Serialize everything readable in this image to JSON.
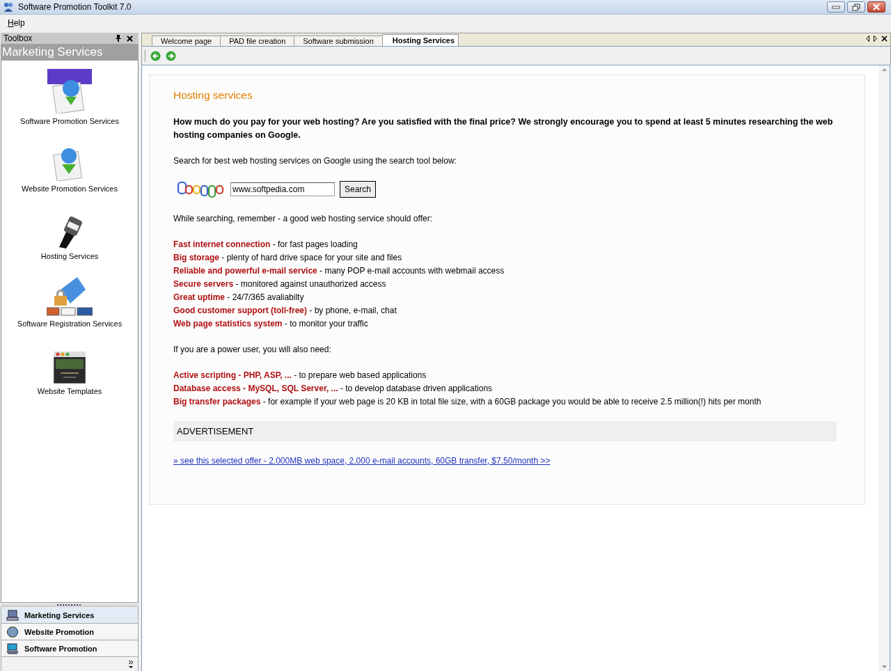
{
  "window": {
    "title": "Software Promotion Toolkit 7.0"
  },
  "menu": [
    {
      "label": "Help"
    }
  ],
  "toolbox": {
    "title": "Toolbox",
    "heading": "Marketing Services",
    "items": [
      {
        "kind": "pad",
        "label": "Software Promotion Services"
      },
      {
        "kind": "globe",
        "label": "Website Promotion Services"
      },
      {
        "kind": "plug",
        "label": "Hosting Services"
      },
      {
        "kind": "lock",
        "label": "Software Registration Services"
      },
      {
        "kind": "template",
        "label": "Website Templates"
      }
    ],
    "sections": [
      {
        "kind": "marketing",
        "label": "Marketing Services",
        "selected": true
      },
      {
        "kind": "globe",
        "label": "Website Promotion",
        "selected": false
      },
      {
        "kind": "computer",
        "label": "Software Promotion",
        "selected": false
      }
    ]
  },
  "tabs": [
    {
      "label": "Welcome page",
      "selected": false
    },
    {
      "label": "PAD file creation",
      "selected": false
    },
    {
      "label": "Software submission",
      "selected": false
    },
    {
      "label": "Hosting Services",
      "selected": true
    }
  ],
  "content": {
    "heading": "Hosting services",
    "intro": "How much do you pay for your web hosting? Are you satisfied with the final price? We strongly encourage you to spend at least 5 minutes researching the web hosting companies on Google.",
    "search_prompt": "Search for best web hosting services on Google using the search tool below:",
    "search": {
      "value": "www.softpedia.com",
      "button": "Search"
    },
    "offer_intro": "While searching, remember - a good web hosting service should offer:",
    "features": [
      "**Fast internet connection** - for fast pages loading",
      "**Big storage** - plenty of hard drive space for your site and files",
      "**Reliable and powerful e-mail service** - many POP e-mail accounts with webmail access",
      "**Secure servers** - monitored against unauthorized access",
      "**Great uptime** - 24/7/365 avaliabilty",
      "**Good customer support (toll-free)** - by phone, e-mail, chat",
      "**Web page statistics system** - to monitor your traffic"
    ],
    "power_intro": "If you are a power user, you will also need:",
    "power_features": [
      "**Active scripting - PHP, ASP, ...** - to prepare web based applications",
      "**Database access - MySQL, SQL Server, ...** - to develop database driven applications",
      "**Big transfer packages** - for example if your web page is 20 KB in total file size, with a 60GB package you would be able to receive 2.5 million(!) hits per month"
    ],
    "ad_heading": "ADVERTISEMENT",
    "ad_link": "» see this selected offer - 2.000MB web space, 2.000 e-mail accounts, 60GB transfer, $7.50/month >>"
  }
}
